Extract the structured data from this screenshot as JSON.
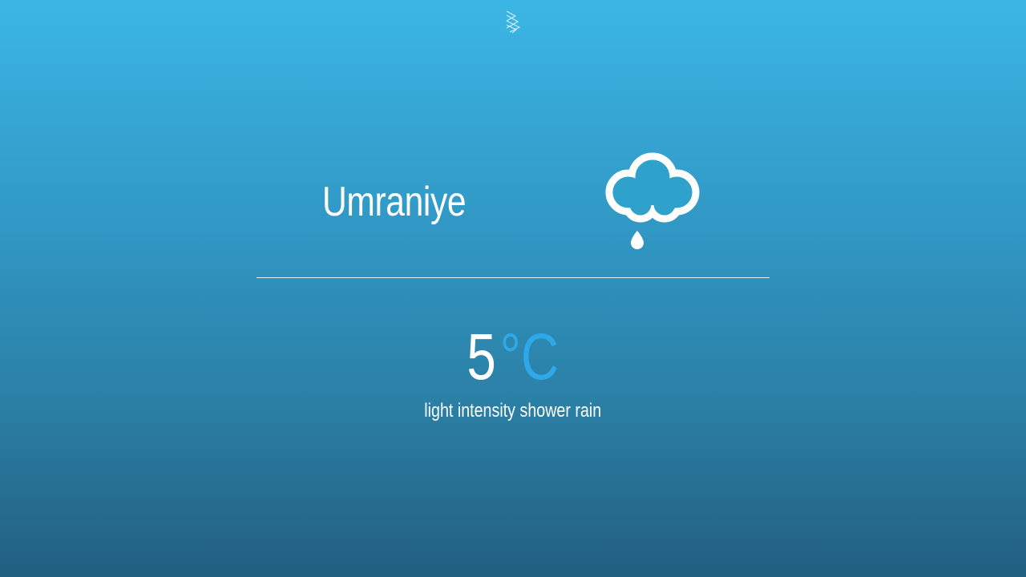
{
  "header": {
    "logo_icon": "stacked-chevrons-logo-icon"
  },
  "weather": {
    "city": "Umraniye",
    "condition_icon": "cloud-raindrop-icon",
    "temperature": "5",
    "unit": "°C",
    "description": "light intensity shower rain"
  },
  "colors": {
    "background_top": "#3bb6e5",
    "background_bottom": "#225f80",
    "text": "#ffffff",
    "unit_accent": "#2ea8e8",
    "divider": "#ffffff"
  }
}
